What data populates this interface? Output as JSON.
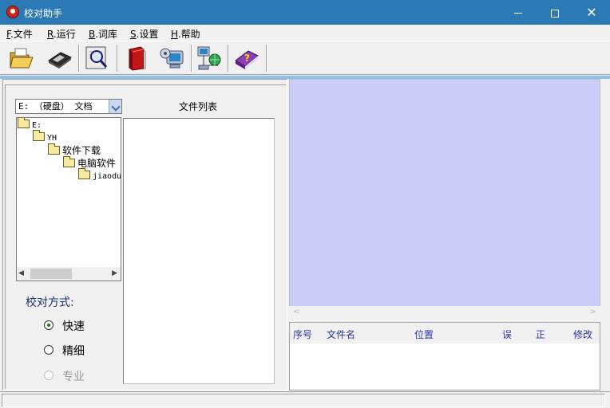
{
  "window": {
    "title": "校对助手",
    "minimize_icon": "minimize-icon",
    "maximize_icon": "maximize-icon",
    "close_label": "✕"
  },
  "menu": [
    {
      "accel": "F",
      "label": ".文件"
    },
    {
      "accel": "R",
      "label": ".运行"
    },
    {
      "accel": "B",
      "label": ".词库"
    },
    {
      "accel": "S",
      "label": ".设置"
    },
    {
      "accel": "H",
      "label": ".帮助"
    }
  ],
  "toolbar": {
    "icons": [
      "open-folder-icon",
      "save-disk-icon",
      "proofread-magnifier-icon",
      "dictionary-book-icon",
      "settings-computer-icon",
      "network-globe-icon",
      "help-book-icon"
    ]
  },
  "left": {
    "drive_select": "E: （硬盘） 文档",
    "file_list_label": "文件列表",
    "tree": [
      "E:",
      "YH",
      "软件下载",
      "电脑软件",
      "jiaodu"
    ],
    "mode_label": "校对方式:",
    "modes": [
      {
        "label": "快速",
        "checked": true,
        "disabled": false
      },
      {
        "label": "精细",
        "checked": false,
        "disabled": false
      },
      {
        "label": "专业",
        "checked": false,
        "disabled": true
      }
    ]
  },
  "results": {
    "columns": [
      "序号",
      "文件名",
      "位置",
      "误",
      "正",
      "修改"
    ]
  },
  "colors": {
    "titlebar": "#2b79b5",
    "preview_bg": "#ccccf9",
    "header_text": "#2a34a8",
    "mode_label": "#1e2f70"
  }
}
